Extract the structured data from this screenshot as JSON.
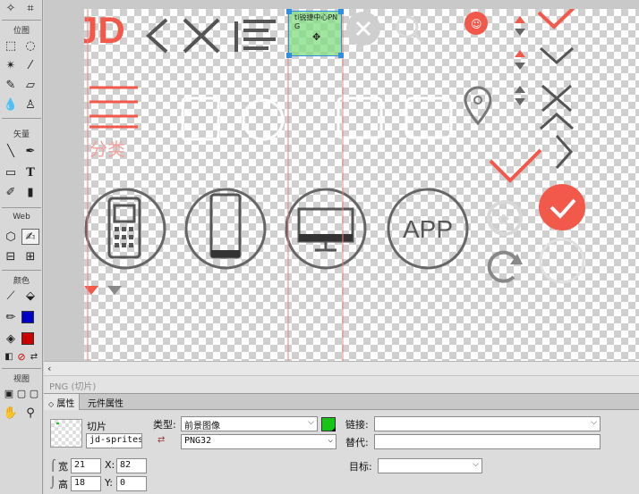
{
  "tools": {
    "sections": {
      "bitmap": "位图",
      "vector": "矢量",
      "web": "Web",
      "colors": "颜色",
      "view": "视图"
    },
    "text_tool": "T",
    "stroke_color": "#0000c8",
    "fill_color": "#cc0000"
  },
  "canvas": {
    "slice_label": "ti锐捷中心PNG",
    "sprite_text": {
      "jd": "JD",
      "category": "分类",
      "app": "APP"
    },
    "colors": {
      "accent": "#f2594b",
      "gray_icon": "#555555",
      "light_icon": "#c8c8c8",
      "slice_fill": "#80dc80",
      "guide_line": "#f08080"
    }
  },
  "statusbar": {
    "text": "PNG (切片)"
  },
  "properties": {
    "tabs": [
      "属性",
      "元件属性"
    ],
    "object_type": "切片",
    "slice_name": "jd-sprites_",
    "type_label": "类型:",
    "type_value": "前景图像",
    "format_value": "PNG32",
    "link_label": "链接:",
    "link_value": "",
    "alt_label": "替代:",
    "alt_value": "",
    "target_label": "目标:",
    "target_value": "",
    "width_label": "宽",
    "width_value": "21",
    "height_label": "高",
    "height_value": "18",
    "x_label": "X:",
    "x_value": "82",
    "y_label": "Y:",
    "y_value": "0",
    "slice_color": "#17c417"
  }
}
